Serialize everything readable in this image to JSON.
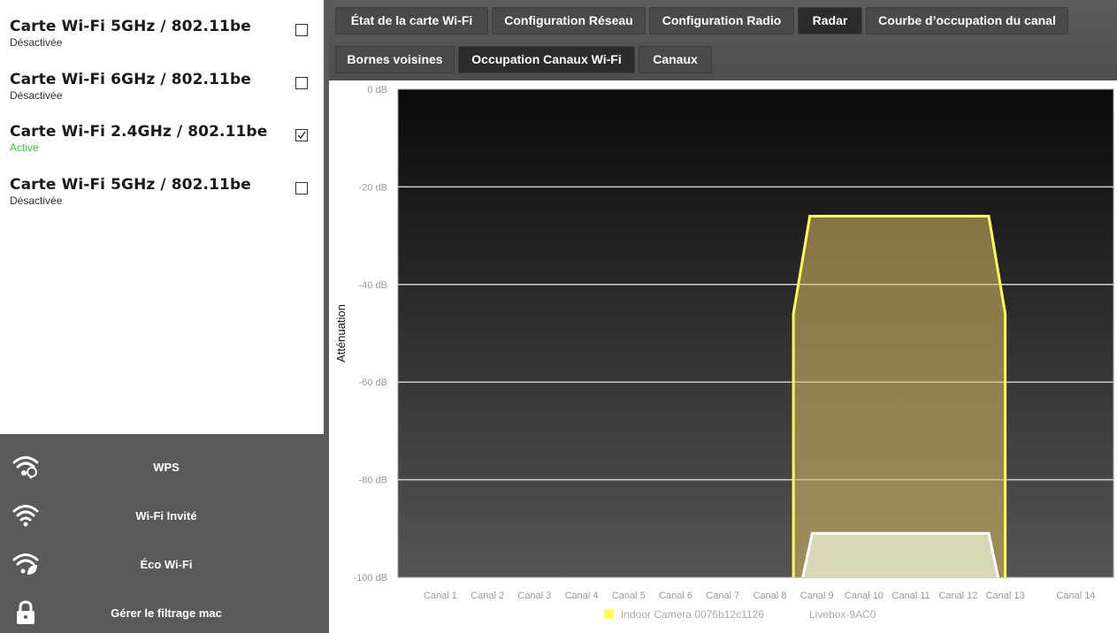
{
  "cards": [
    {
      "title": "Carte Wi-Fi 5GHz / 802.11be",
      "status": "Désactivée",
      "checked": false
    },
    {
      "title": "Carte Wi-Fi 6GHz / 802.11be",
      "status": "Désactivée",
      "checked": false
    },
    {
      "title": "Carte Wi-Fi 2.4GHz / 802.11be",
      "status": "Active",
      "checked": true
    },
    {
      "title": "Carte Wi-Fi 5GHz / 802.11be",
      "status": "Désactivée",
      "checked": false
    }
  ],
  "menu": [
    {
      "label": "WPS",
      "icon": "wifi-wps-icon"
    },
    {
      "label": "Wi-Fi Invité",
      "icon": "wifi-icon"
    },
    {
      "label": "Éco Wi-Fi",
      "icon": "wifi-eco-leaf-icon"
    },
    {
      "label": "Gérer le filtrage mac",
      "icon": "lock-icon"
    }
  ],
  "tabs_row1": [
    {
      "label": "État de la carte Wi-Fi",
      "selected": false
    },
    {
      "label": "Configuration Réseau",
      "selected": false
    },
    {
      "label": "Configuration Radio",
      "selected": false
    },
    {
      "label": "Radar",
      "selected": true
    },
    {
      "label": "Courbe d’occupation du canal",
      "selected": false
    }
  ],
  "tabs_row2": [
    {
      "label": "Bornes voisines",
      "selected": false
    },
    {
      "label": "Occupation Canaux Wi-Fi",
      "selected": true
    },
    {
      "label": "Canaux",
      "selected": false
    }
  ],
  "colors": {
    "accent_active": "#2ec82e",
    "series_camera": "#ffff55",
    "series_livebox": "#ffffff"
  },
  "chart_data": {
    "type": "area",
    "ylabel": "Atténuation",
    "ylim": [
      -100,
      0
    ],
    "yticks": [
      {
        "value": 0,
        "label": "0 dB"
      },
      {
        "value": -20,
        "label": "-20 dB"
      },
      {
        "value": -40,
        "label": "-40 dB"
      },
      {
        "value": -60,
        "label": "-60 dB"
      },
      {
        "value": -80,
        "label": "-80 dB"
      },
      {
        "value": -100,
        "label": "-100 dB"
      }
    ],
    "xlim": [
      0.1,
      15.3
    ],
    "categories": [
      {
        "x": 1,
        "label": "Canal 1"
      },
      {
        "x": 2,
        "label": "Canal 2"
      },
      {
        "x": 3,
        "label": "Canal 3"
      },
      {
        "x": 4,
        "label": "Canal 4"
      },
      {
        "x": 5,
        "label": "Canal 5"
      },
      {
        "x": 6,
        "label": "Canal 6"
      },
      {
        "x": 7,
        "label": "Canal 7"
      },
      {
        "x": 8,
        "label": "Canal 8"
      },
      {
        "x": 9,
        "label": "Canal 9"
      },
      {
        "x": 10,
        "label": "Canal 10"
      },
      {
        "x": 11,
        "label": "Canal 11"
      },
      {
        "x": 12,
        "label": "Canal 12"
      },
      {
        "x": 13,
        "label": "Canal 13"
      },
      {
        "x": 14.5,
        "label": "Canal 14"
      }
    ],
    "grid": true,
    "legend_position": "bottom",
    "series": [
      {
        "name": "Indoor Camera 0076b12c1126",
        "color": "#ffff55",
        "points": [
          [
            8.5,
            -100
          ],
          [
            8.5,
            -46
          ],
          [
            8.85,
            -26
          ],
          [
            12.65,
            -26
          ],
          [
            13,
            -46
          ],
          [
            13,
            -100
          ]
        ]
      },
      {
        "name": "Livebox-9AC0",
        "color": "#ffffff",
        "points": [
          [
            8.7,
            -100
          ],
          [
            8.9,
            -91
          ],
          [
            12.65,
            -91
          ],
          [
            12.85,
            -100
          ]
        ]
      }
    ]
  }
}
